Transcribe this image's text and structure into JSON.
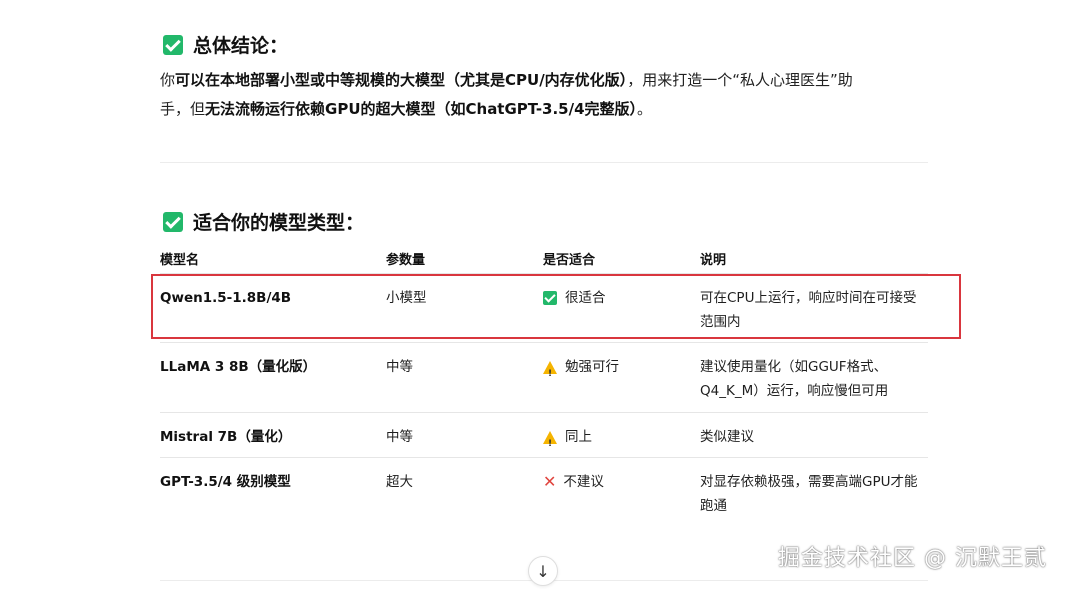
{
  "conclusion": {
    "heading": "总体结论：",
    "line1_a": "你",
    "line1_b": "可以在本地部署小型或中等规模的大模型（尤其是CPU/内存优化版）",
    "line1_c": "，用来打造一个“私人心理医生”助",
    "line2_a": "手，但",
    "line2_b": "无法流畅运行依赖GPU的超大模型（如ChatGPT-3.5/4完整版）",
    "line2_c": "。"
  },
  "models_section": {
    "heading": "适合你的模型类型：",
    "columns": [
      "模型名",
      "参数量",
      "是否适合",
      "说明"
    ],
    "rows": [
      {
        "name": "Qwen1.5-1.8B/4B",
        "size": "小模型",
        "status_icon": "check-icon",
        "status": "很适合",
        "note": "可在CPU上运行，响应时间在可接受范围内"
      },
      {
        "name": "LLaMA 3 8B（量化版）",
        "size": "中等",
        "status_icon": "warning-icon",
        "status": "勉强可行",
        "note": "建议使用量化（如GGUF格式、Q4_K_M）运行，响应慢但可用"
      },
      {
        "name": "Mistral 7B（量化）",
        "size": "中等",
        "status_icon": "warning-icon",
        "status": "同上",
        "note": "类似建议"
      },
      {
        "name": "GPT-3.5/4 级别模型",
        "size": "超大",
        "status_icon": "cross-icon",
        "status": "不建议",
        "note": "对显存依赖极强，需要高端GPU才能跑通"
      }
    ]
  },
  "scroll_button_icon": "arrow-down-icon",
  "watermark": "掘金技术社区 @ 沉默王贰",
  "colors": {
    "check": "#22b86a",
    "warning": "#f5b400",
    "cross": "#e0443e",
    "highlight": "#d9363e"
  }
}
